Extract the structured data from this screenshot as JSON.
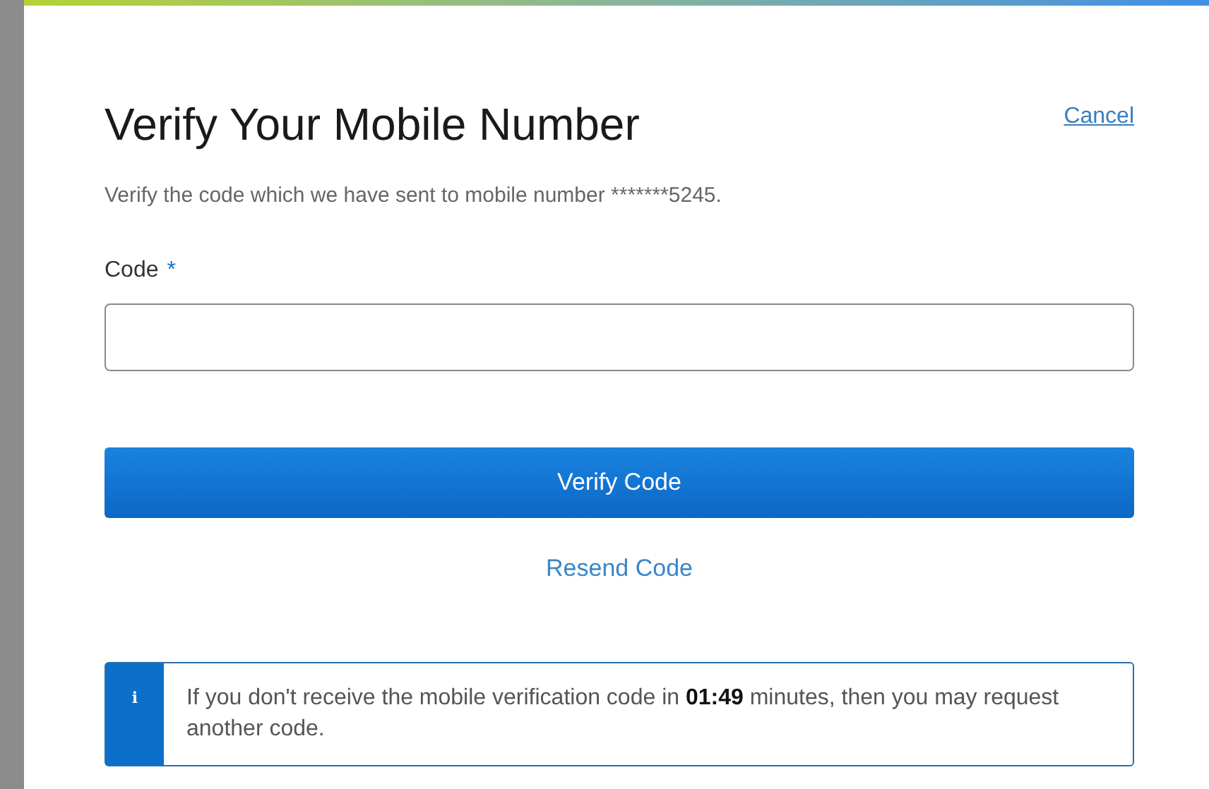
{
  "dialog": {
    "title": "Verify Your Mobile Number",
    "cancel_link": "Cancel",
    "description": "Verify the code which we have sent to mobile number *******5245.",
    "field": {
      "label": "Code",
      "required_mark": "*"
    },
    "verify_button": "Verify Code",
    "resend_link": "Resend Code",
    "notice": {
      "icon": "i",
      "text": "If you don't receive the mobile verification code in **01:49** minutes, then you may request another code."
    }
  }
}
